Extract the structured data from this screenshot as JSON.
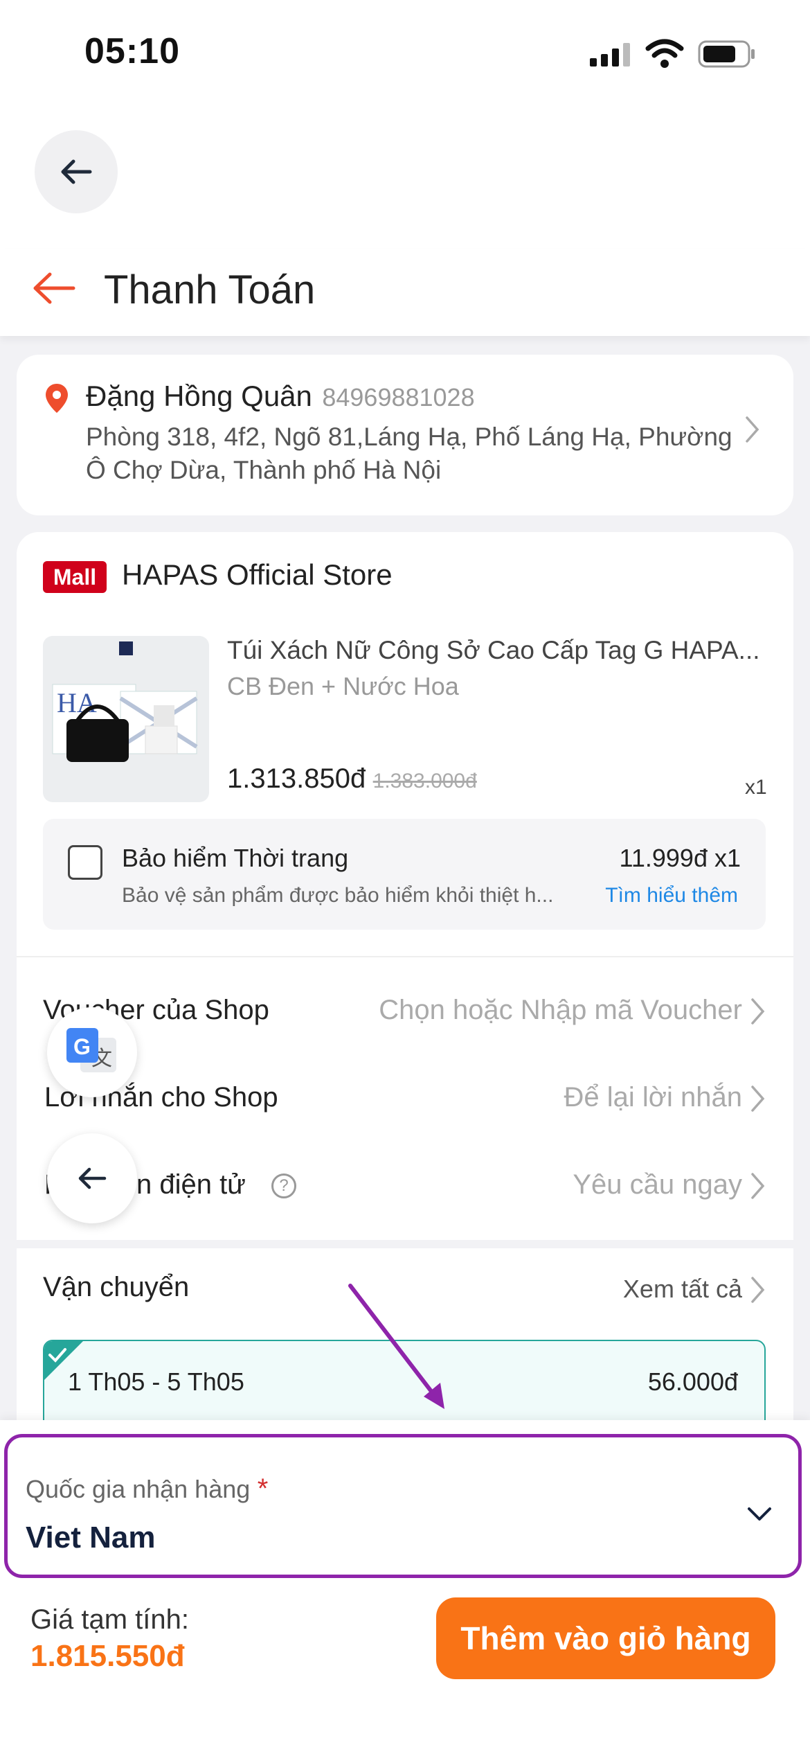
{
  "status": {
    "time": "05:10"
  },
  "header": {
    "title": "Thanh Toán"
  },
  "address": {
    "name": "Đặng Hồng Quân",
    "phone": "84969881028",
    "line1": "Phòng 318, 4f2, Ngõ 81,Láng Hạ, Phố Láng Hạ, Phường",
    "line2": "Ô Chợ Dừa, Thành phố Hà Nội"
  },
  "shop": {
    "badge": "Mall",
    "name": "HAPAS Official Store"
  },
  "product": {
    "title": "Túi Xách Nữ Công Sở Cao Cấp Tag G HAPA...",
    "variant": "CB Đen + Nước Hoa",
    "price": "1.313.850đ",
    "original_price": "1.383.000đ",
    "qty": "x1"
  },
  "insurance": {
    "title": "Bảo hiểm Thời trang",
    "price": "11.999đ x1",
    "desc": "Bảo vệ sản phẩm được bảo hiểm khỏi thiệt h...",
    "link": "Tìm hiểu thêm"
  },
  "rows": {
    "voucher_label": "Voucher của Shop",
    "voucher_value": "Chọn hoặc Nhập mã Voucher",
    "message_label": "Lời nhắn cho Shop",
    "message_value": "Để lại lời nhắn",
    "invoice_label": "Hóa đơn điện tử",
    "invoice_value": "Yêu cầu ngay"
  },
  "shipping": {
    "label": "Vận chuyển",
    "see_all": "Xem tất cả",
    "date_range": "1 Th05 - 5 Th05",
    "fee": "56.000đ"
  },
  "country": {
    "label": "Quốc gia nhận hàng",
    "required": "*",
    "value": "Viet Nam"
  },
  "footer": {
    "subtotal_label": "Giá tạm tính:",
    "subtotal": "1.815.550đ",
    "add_to_cart": "Thêm vào giỏ hàng"
  },
  "colors": {
    "accent": "#f97316",
    "brand_red": "#ee4d2d",
    "highlight": "#8e24aa",
    "link": "#1e88e5"
  }
}
